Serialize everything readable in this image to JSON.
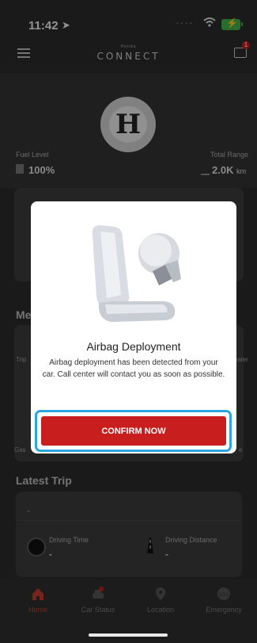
{
  "status_bar": {
    "time": "11:42"
  },
  "header": {
    "logo_small": "Honda",
    "logo_main": "CONNECT",
    "notification_count": "1"
  },
  "metrics": {
    "fuel_label": "Fuel Level",
    "fuel_value": "100%",
    "range_label": "Total Range",
    "range_value": "2.0K",
    "range_unit": "km"
  },
  "background_fragments": {
    "menu_section": "Me",
    "tile_left_1": "Trip",
    "tile_right_1": "ealer",
    "tile_left_2": "Gas",
    "tile_right_2": "e"
  },
  "latest_trip": {
    "title": "Latest Trip",
    "trip_value": "-",
    "driving_time_label": "Driving Time",
    "driving_time_value": "-",
    "driving_distance_label": "Driving Distance",
    "driving_distance_value": "-"
  },
  "bottom_nav": {
    "items": [
      {
        "label": "Home",
        "icon": "home-icon",
        "active": true
      },
      {
        "label": "Car Status",
        "icon": "car-status-icon",
        "active": false
      },
      {
        "label": "Location",
        "icon": "location-pin-icon",
        "active": false
      },
      {
        "label": "Emergency",
        "icon": "sos-icon",
        "active": false
      }
    ]
  },
  "modal": {
    "title": "Airbag Deployment",
    "message": "Airbag deployment has been detected from your car. Call center will contact you as soon as possible.",
    "confirm_label": "CONFIRM NOW"
  },
  "colors": {
    "accent_red": "#c81e1e",
    "highlight_blue": "#2aa7e0",
    "battery_green": "#3fb24a"
  }
}
